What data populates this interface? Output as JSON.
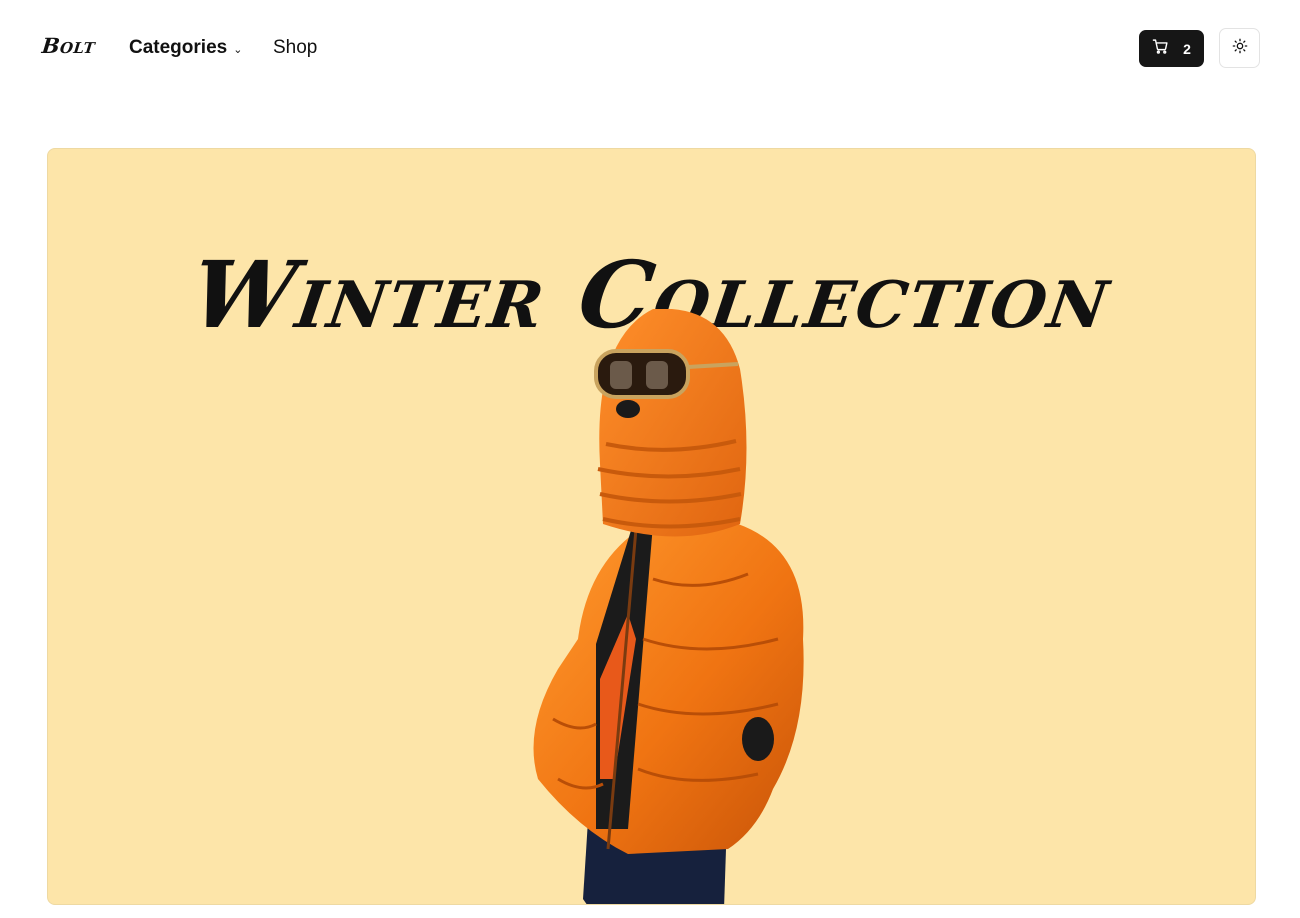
{
  "nav": {
    "logo": "Bolt",
    "categories_label": "Categories",
    "shop_label": "Shop",
    "cart_count": "2",
    "cart_icon": "cart-icon",
    "theme_icon": "sun-icon"
  },
  "hero": {
    "title": "Winter Collection",
    "background": "#fde5a9",
    "image_subject": "person-in-orange-puffer-jacket"
  }
}
